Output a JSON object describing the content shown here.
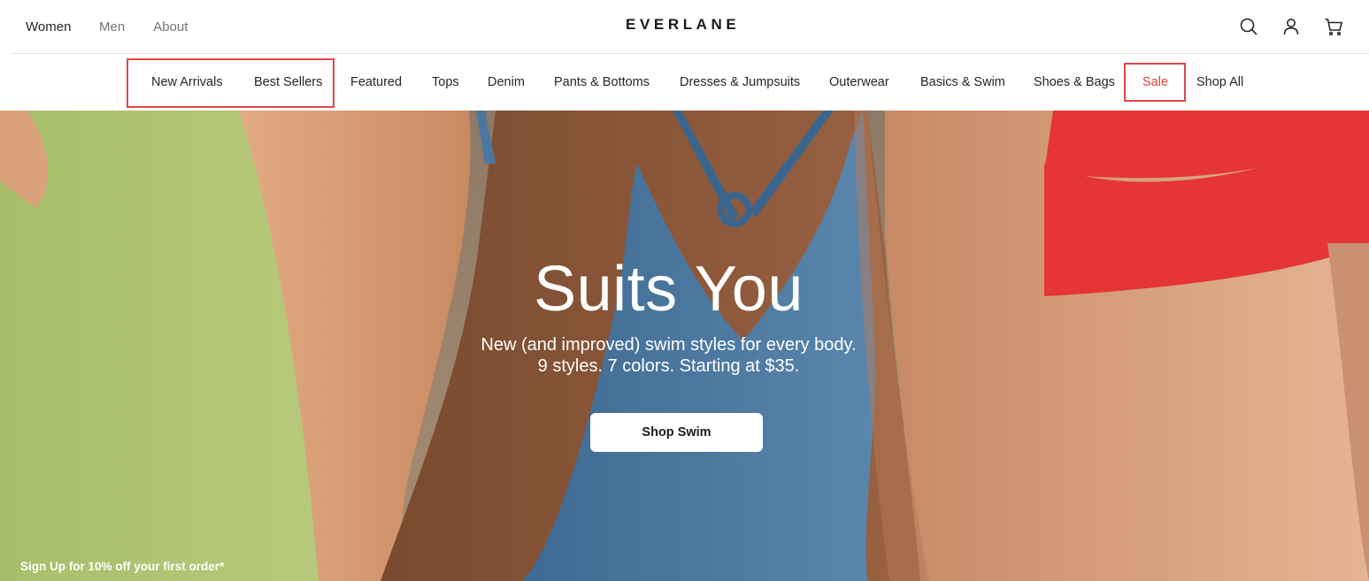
{
  "brand": {
    "logo": "EVERLANE"
  },
  "gender_tabs": [
    {
      "label": "Women",
      "active": true
    },
    {
      "label": "Men",
      "active": false
    },
    {
      "label": "About",
      "active": false
    }
  ],
  "utility_icons": [
    "search-icon",
    "account-icon",
    "cart-icon"
  ],
  "categories": [
    {
      "label": "New Arrivals"
    },
    {
      "label": "Best Sellers"
    },
    {
      "label": "Featured"
    },
    {
      "label": "Tops"
    },
    {
      "label": "Denim"
    },
    {
      "label": "Pants & Bottoms"
    },
    {
      "label": "Dresses & Jumpsuits"
    },
    {
      "label": "Outerwear"
    },
    {
      "label": "Basics & Swim"
    },
    {
      "label": "Shoes & Bags"
    },
    {
      "label": "Sale"
    },
    {
      "label": "Shop All"
    }
  ],
  "hero": {
    "title": "Suits You",
    "subtitle_line1": "New (and improved) swim styles for every body.",
    "subtitle_line2": "9 styles. 7 colors. Starting at $35.",
    "cta_label": "Shop Swim"
  },
  "promo": {
    "text": "Sign Up for 10% off your first order*"
  },
  "colors": {
    "sale": "#d8463b",
    "highlight": "#e0484a",
    "text": "#262626"
  }
}
